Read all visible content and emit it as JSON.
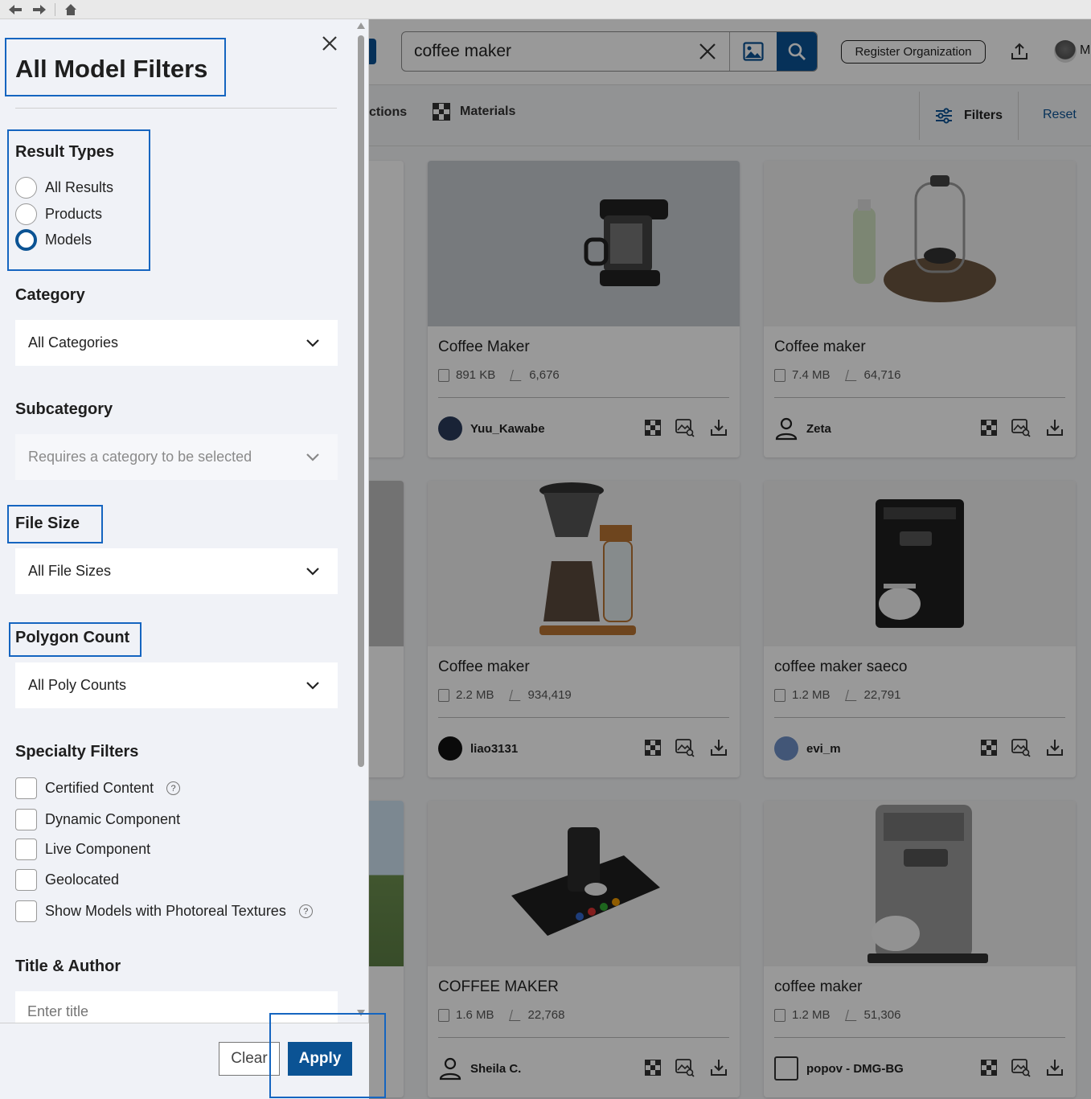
{
  "search": {
    "query": "coffee maker"
  },
  "header": {
    "register_label": "Register Organization",
    "avatar_letter": "M"
  },
  "tabs": {
    "collections": "ctions",
    "materials": "Materials"
  },
  "toolbar": {
    "filters_label": "Filters",
    "reset_label": "Reset"
  },
  "cards": [
    {
      "title": "Coffee Maker",
      "size": "891 KB",
      "polys": "6,676",
      "author": "Yuu_Kawabe"
    },
    {
      "title": "Coffee maker",
      "size": "7.4 MB",
      "polys": "64,716",
      "author": "Zeta"
    },
    {
      "title": "Coffee maker",
      "size": "2.2 MB",
      "polys": "934,419",
      "author": "liao3131"
    },
    {
      "title": "coffee maker saeco",
      "size": "1.2 MB",
      "polys": "22,791",
      "author": "evi_m"
    },
    {
      "title": "COFFEE MAKER",
      "size": "1.6 MB",
      "polys": "22,768",
      "author": "Sheila C."
    },
    {
      "title": "coffee maker",
      "size": "1.2 MB",
      "polys": "51,306",
      "author": "popov - DMG-BG"
    }
  ],
  "panel": {
    "title": "All Model Filters",
    "result_types": {
      "label": "Result Types",
      "options": [
        "All Results",
        "Products",
        "Models"
      ],
      "selected": "Models"
    },
    "category": {
      "label": "Category",
      "value": "All Categories"
    },
    "subcategory": {
      "label": "Subcategory",
      "placeholder": "Requires a category to be selected"
    },
    "file_size": {
      "label": "File Size",
      "value": "All File Sizes"
    },
    "polygon_count": {
      "label": "Polygon Count",
      "value": "All Poly Counts"
    },
    "specialty": {
      "label": "Specialty Filters",
      "options": [
        "Certified Content",
        "Dynamic Component",
        "Live Component",
        "Geolocated",
        "Show Models with Photoreal Textures"
      ]
    },
    "title_author": {
      "label": "Title & Author",
      "placeholder": "Enter title"
    },
    "footer": {
      "clear_label": "Clear",
      "apply_label": "Apply"
    }
  },
  "colors": {
    "accent": "#0b5394",
    "highlight": "#1565c0",
    "panel_bg": "#f0f2f7"
  }
}
